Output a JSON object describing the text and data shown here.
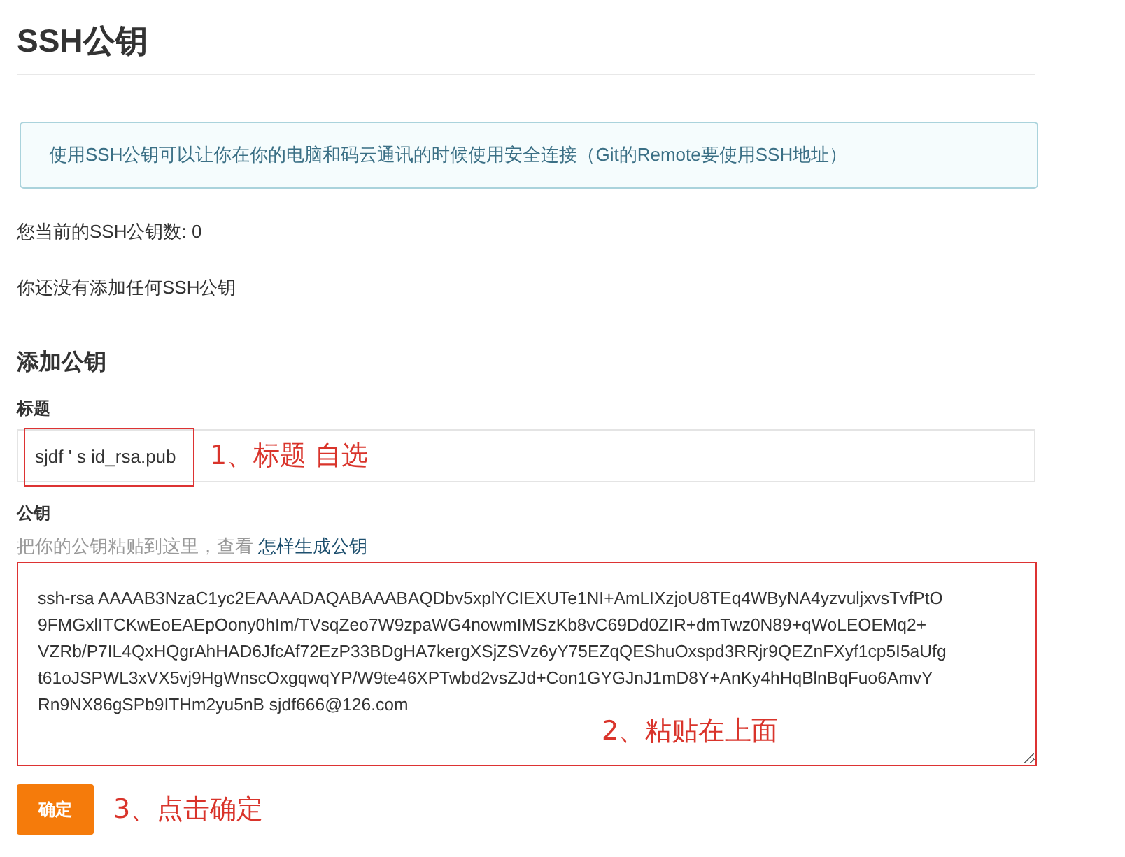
{
  "page_title": "SSH公钥",
  "info": "使用SSH公钥可以让你在你的电脑和码云通讯的时候使用安全连接（Git的Remote要使用SSH地址）",
  "key_count": "您当前的SSH公钥数: 0",
  "empty_note": "你还没有添加任何SSH公钥",
  "form": {
    "heading": "添加公钥",
    "title_field": {
      "label": "标题",
      "value": "sjdf ' s id_rsa.pub"
    },
    "key_field": {
      "label": "公钥",
      "hint": "把你的公钥粘贴到这里，查看",
      "hint_link": "怎样生成公钥",
      "value_lines": [
        "ssh-rsa AAAAB3NzaC1yc2EAAAADAQABAAABAQDbv5xplYCIEXUTe1NI+AmLIXzjoU8TEq4WByNA4yzvuljxvsTvfPtO",
        "9FMGxlITCKwEoEAEpOony0hIm/TVsqZeo7W9zpaWG4nowmIMSzKb8vC69Dd0ZIR+dmTwz0N89+qWoLEOEMq2+",
        "VZRb/P7IL4QxHQgrAhHAD6JfcAf72EzP33BDgHA7kergXSjZSVz6yY75EZqQEShuOxspd3RRjr9QEZnFXyf1cp5I5aUfg",
        "t61oJSPWL3xVX5vj9HgWnscOxgqwqYP/W9te46XPTwbd2vsZJd+Con1GYGJnJ1mD8Y+AnKy4hHqBlnBqFuo6AmvY",
        "Rn9NX86gSPb9ITHm2yu5nB sjdf666@126.com"
      ]
    },
    "submit": "确定"
  },
  "annotations": [
    "1、标题 自选",
    "2、粘贴在上面",
    "3、点击确定"
  ]
}
